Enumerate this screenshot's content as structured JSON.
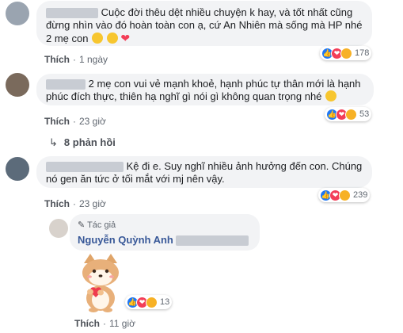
{
  "comments": [
    {
      "text": "Cuộc đời thêu dệt nhiều chuyện k hay, và tốt nhất cũng đừng nhìn vào đó hoàn toàn con ạ, cứ An Nhiên mà sống mà HP nhé 2 mẹ con",
      "emojis": [
        "heart-eyes",
        "kiss",
        "heart"
      ],
      "like_label": "Thích",
      "time": "1 ngày",
      "reactions": [
        "like",
        "love",
        "haha"
      ],
      "reaction_count": "178"
    },
    {
      "text": "2 mẹ con vui vẻ mạnh khoẻ, hạnh phúc tự thân mới là hạnh phúc đích thực, thiên hạ nghĩ gì nói gì không quan trọng nhé",
      "emojis": [
        "wink"
      ],
      "like_label": "Thích",
      "time": "23 giờ",
      "reactions": [
        "like",
        "love",
        "haha"
      ],
      "reaction_count": "53",
      "replies_label": "8 phản hồi"
    },
    {
      "text_line1": "Kệ đi e. Suy nghĩ nhiều ảnh hưởng đến con. Chúng",
      "text_line2": "nó gen ăn tức ở tối mắt với mj nên vậy.",
      "like_label": "Thích",
      "time": "23 giờ",
      "reactions": [
        "like",
        "love",
        "haha"
      ],
      "reaction_count": "239"
    }
  ],
  "reply": {
    "author_badge": "Tác giả",
    "author_name": "Nguyễn Quỳnh Anh",
    "sticker": "shiba-dog-holding-heart",
    "like_label": "Thích",
    "time": "11 giờ",
    "reactions": [
      "like",
      "love",
      "haha"
    ],
    "reaction_count": "13"
  },
  "colors": {
    "bubble_bg": "#f2f3f5",
    "link": "#385898",
    "like_blue": "#2078f4",
    "love_red": "#f33e58",
    "haha_yellow": "#f7b125"
  }
}
